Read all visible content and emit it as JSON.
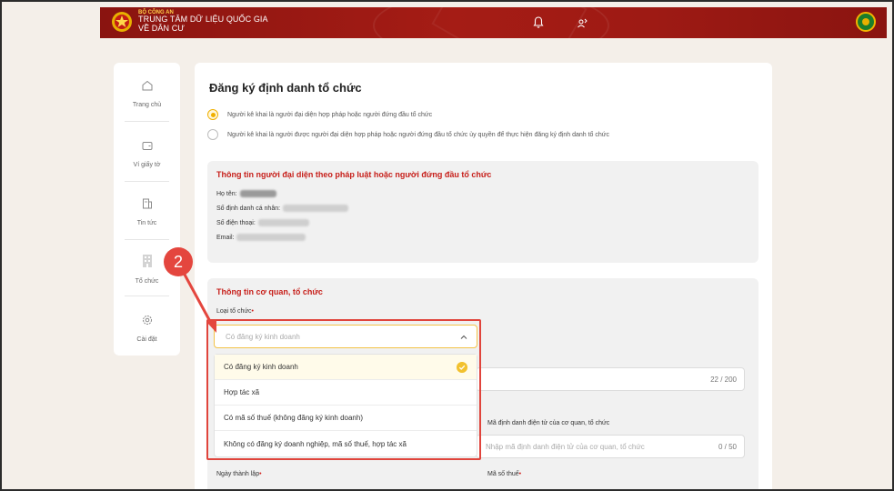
{
  "header": {
    "ministry": "BỘ CÔNG AN",
    "center_line1": "TRUNG TÂM DỮ LIỆU QUỐC GIA",
    "center_line2": "VỀ DÂN CƯ",
    "icons": [
      "bell-icon",
      "user-switch-icon",
      "avatar"
    ]
  },
  "sidebar": {
    "items": [
      {
        "label": "Trang chủ",
        "icon": "home-icon"
      },
      {
        "label": "Ví giấy tờ",
        "icon": "wallet-icon"
      },
      {
        "label": "Tin tức",
        "icon": "news-icon"
      },
      {
        "label": "Tổ chức",
        "icon": "building-icon"
      },
      {
        "label": "Cài đặt",
        "icon": "gear-icon"
      }
    ]
  },
  "main": {
    "title": "Đăng ký định danh tổ chức",
    "radio_options": [
      {
        "label": "Người kê khai là người đại diện hợp pháp hoặc người đứng đầu tổ chức",
        "selected": true
      },
      {
        "label": "Người kê khai là người được người đại diện hợp pháp hoặc người đứng đầu tổ chức ủy quyền để thực hiện đăng ký định danh tổ chức",
        "selected": false
      }
    ],
    "representative": {
      "title": "Thông tin người đại diện theo pháp luật hoặc người đứng đầu tổ chức",
      "name_label": "Họ tên:",
      "id_label": "Số định danh cá nhân:",
      "phone_label": "Số điện thoại:",
      "email_label": "Email:"
    },
    "org": {
      "title": "Thông tin cơ quan, tổ chức",
      "type_label": "Loại tổ chức",
      "type_placeholder": "Có đăng ký kinh doanh",
      "type_options": [
        "Có đăng ký kinh doanh",
        "Hợp tác xã",
        "Có mã số thuế (không đăng ký kinh doanh)",
        "Không có đăng ký doanh nghiệp, mã số thuế, hợp tác xã"
      ],
      "name_counter": "22 / 200",
      "eid_label": "Mã định danh điện tử của cơ quan, tổ chức",
      "eid_placeholder": "Nhập mã định danh điện tử của cơ quan, tổ chức",
      "eid_counter": "0 / 50",
      "founded_label": "Ngày thành lập",
      "tax_label": "Mã số thuế"
    }
  },
  "annotation": {
    "step": "2"
  },
  "colors": {
    "header": "#a51c15",
    "accent": "#f0b000",
    "title_red": "#c7201b",
    "highlight": "#e4463e"
  }
}
